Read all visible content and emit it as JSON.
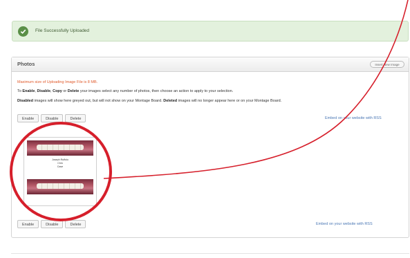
{
  "top_links": [
    "",
    ""
  ],
  "flash": {
    "message": "File Successfully Uploaded"
  },
  "panel": {
    "title": "Photos",
    "insert_button": "Insert New Image",
    "max_size_note": "Maximum size of Uploading Image File is 8 MB.",
    "instructions": {
      "prefix": "To ",
      "enable": "Enable",
      "comma1": ", ",
      "disable": "Disable",
      "comma2": ", ",
      "copy": "Copy",
      "or": " or ",
      "delete": "Delete",
      "rest": " your images select any number of photos, then choose an action to apply to your selection."
    },
    "instructions2": {
      "disabled": "Disabled",
      "mid": " images will show here greyed out, but will not show on your Montage Board. ",
      "deleted": "Deleted",
      "end": " images will no longer appear here or on your Montage Board."
    },
    "actions": {
      "enable": "Enable",
      "disable": "Disable",
      "delete": "Delete"
    },
    "rss_link": "Embed on your website with RSS",
    "thumbnail": {
      "caption_lines": [
        "Joseph Ruffolo",
        "Chin",
        "Case"
      ]
    }
  },
  "colors": {
    "accent_red": "#d61f2b",
    "success_green": "#e3f1dd",
    "warning": "#e05a2b",
    "link": "#4a77b4"
  }
}
